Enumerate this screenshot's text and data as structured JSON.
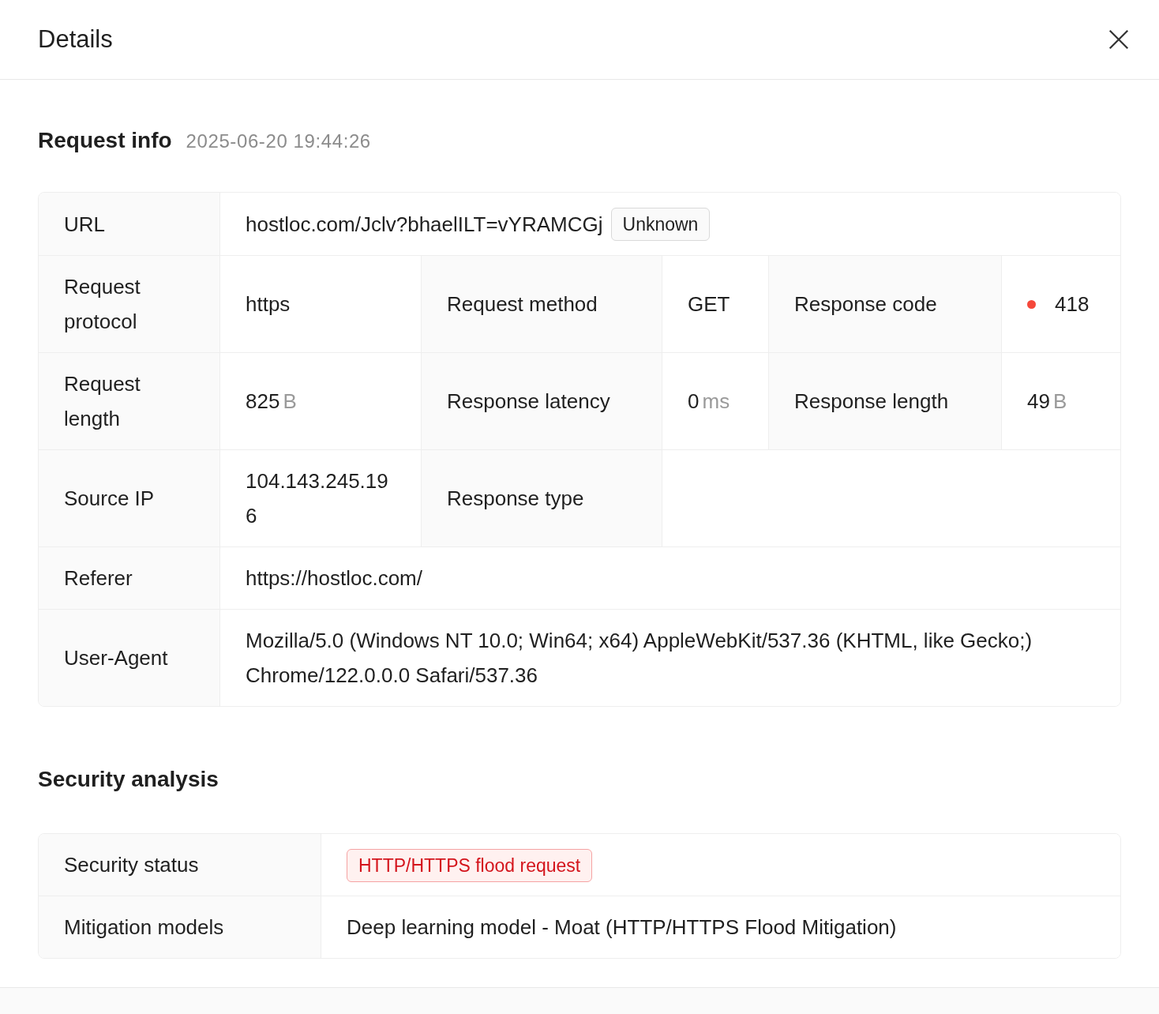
{
  "header": {
    "title": "Details"
  },
  "request_info": {
    "title": "Request info",
    "timestamp": "2025-06-20 19:44:26",
    "url": {
      "label": "URL",
      "value": "hostloc.com/Jclv?bhaelILT=vYRAMCGj",
      "badge": "Unknown"
    },
    "grid_rows": [
      [
        {
          "label": "Request protocol",
          "value": "https"
        },
        {
          "label": "Request method",
          "value": "GET"
        },
        {
          "label": "Response code",
          "value": "418",
          "color": "#f5483b"
        }
      ],
      [
        {
          "label": "Request length",
          "value": "825",
          "unit": "B"
        },
        {
          "label": "Response latency",
          "value": "0",
          "unit": "ms"
        },
        {
          "label": "Response length",
          "value": "49",
          "unit": "B"
        }
      ],
      [
        {
          "label": "Source IP",
          "value": "104.143.245.196"
        },
        {
          "label": "Response type"
        }
      ]
    ],
    "referer": {
      "label": "Referer",
      "value": "https://hostloc.com/"
    },
    "user_agent": {
      "label": "User-Agent",
      "value": "Mozilla/5.0 (Windows NT 10.0; Win64; x64) AppleWebKit/537.36 (KHTML, like Gecko;) Chrome/122.0.0.0 Safari/537.36"
    }
  },
  "security_analysis": {
    "title": "Security analysis",
    "status": {
      "label": "Security status",
      "tag": "HTTP/HTTPS flood request"
    },
    "models": {
      "label": "Mitigation models",
      "value": "Deep learning model - Moat (HTTP/HTTPS Flood Mitigation)"
    }
  }
}
